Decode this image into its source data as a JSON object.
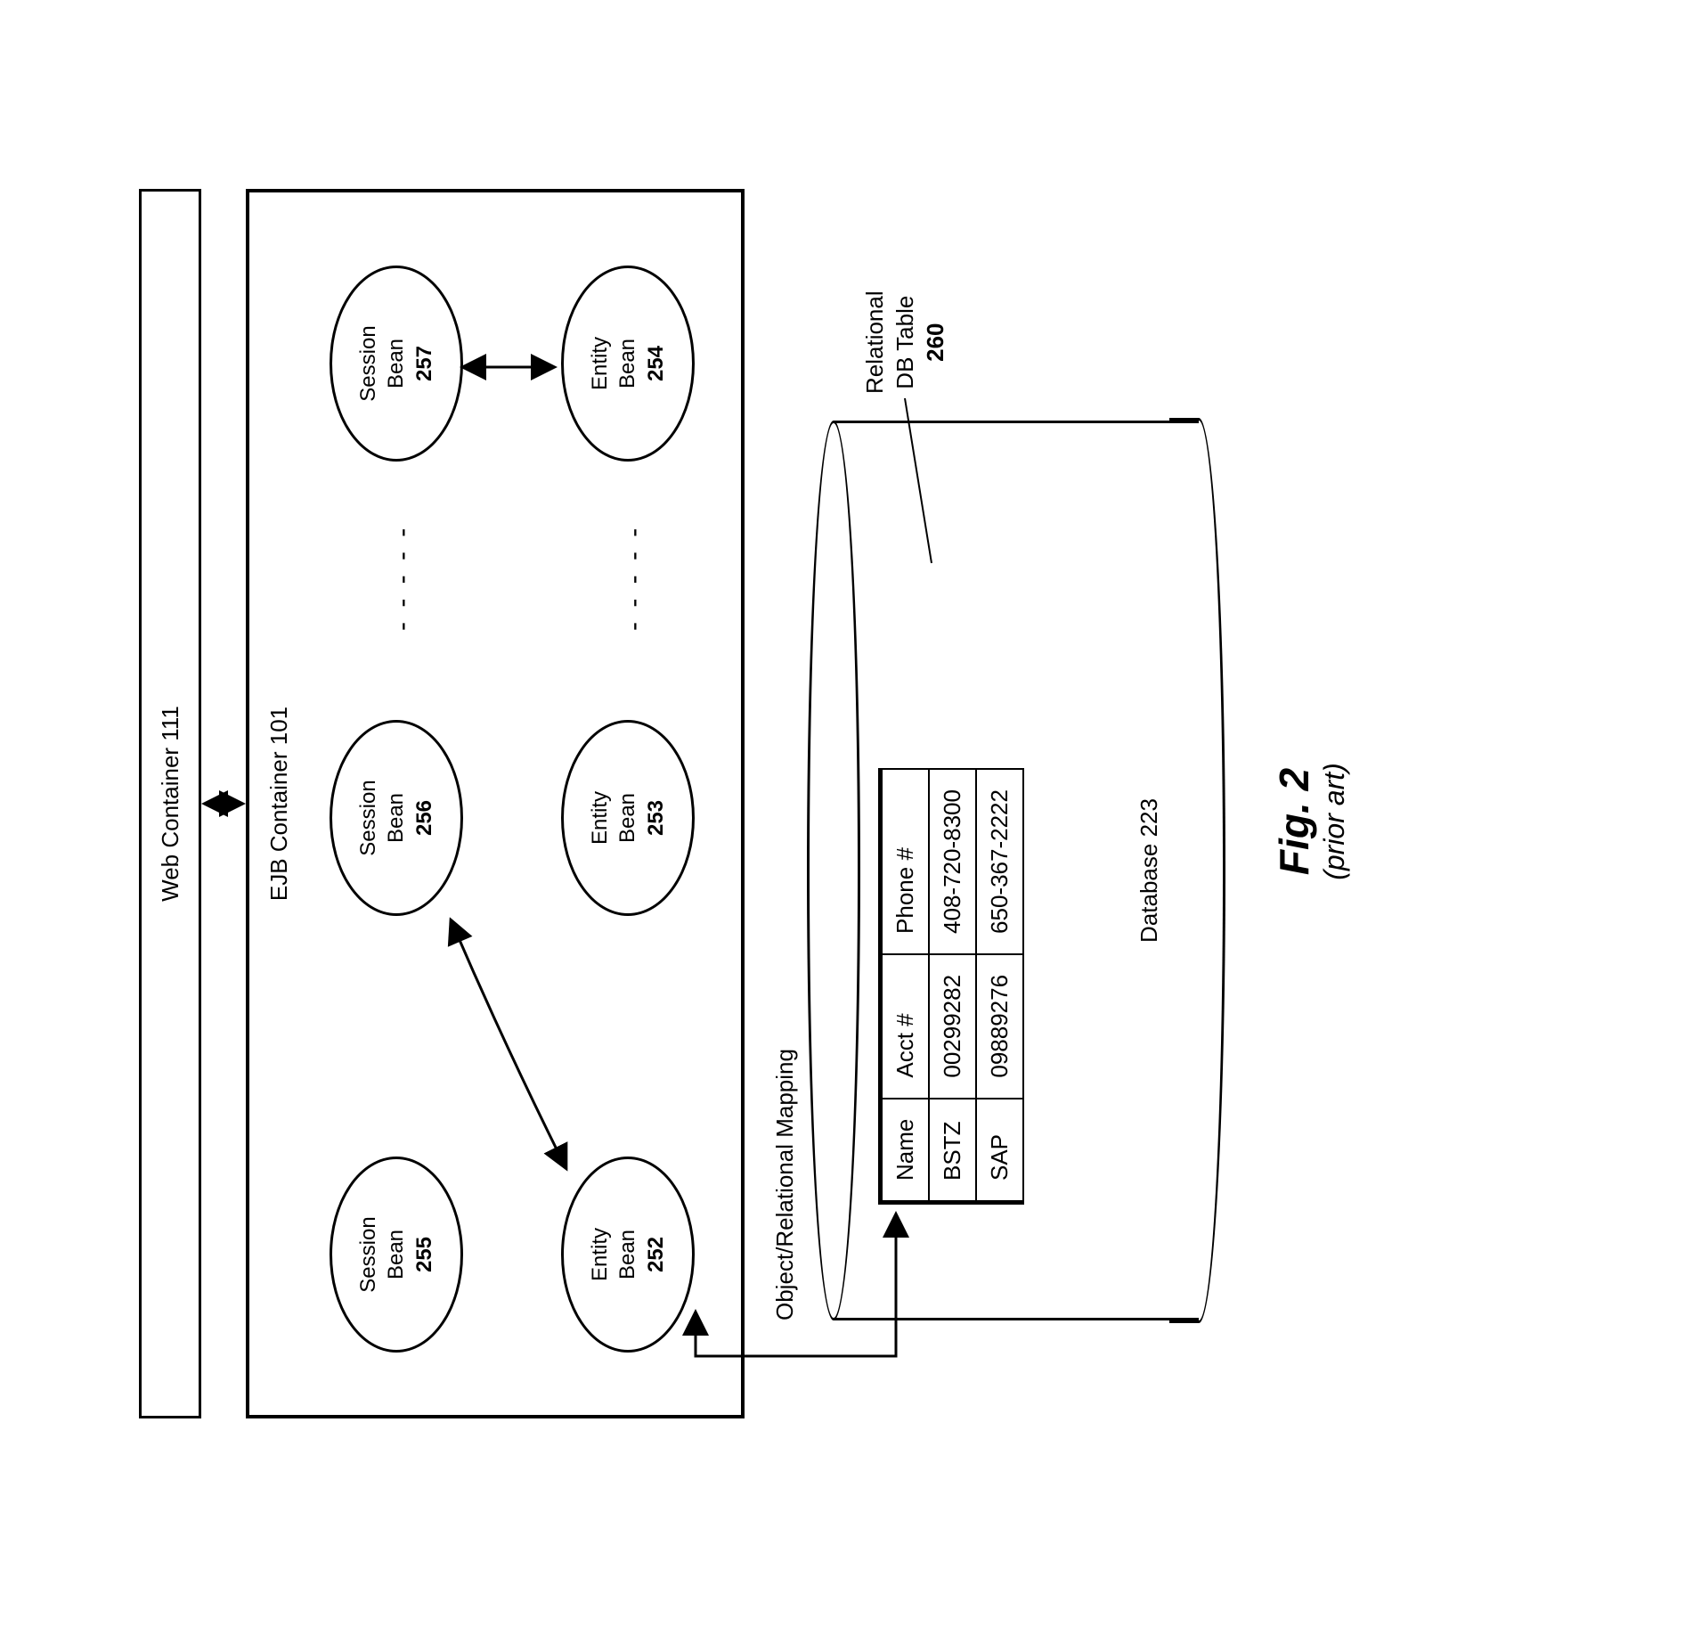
{
  "web_container": {
    "label": "Web Container 111"
  },
  "ejb_container": {
    "label": "EJB Container 101"
  },
  "beans": {
    "s255": {
      "type": "Session",
      "word": "Bean",
      "num": "255"
    },
    "s256": {
      "type": "Session",
      "word": "Bean",
      "num": "256"
    },
    "s257": {
      "type": "Session",
      "word": "Bean",
      "num": "257"
    },
    "e252": {
      "type": "Entity",
      "word": "Bean",
      "num": "252"
    },
    "e253": {
      "type": "Entity",
      "word": "Bean",
      "num": "253"
    },
    "e254": {
      "type": "Entity",
      "word": "Bean",
      "num": "254"
    }
  },
  "orm_label": "Object/Relational Mapping",
  "database": {
    "label": "Database 223"
  },
  "table": {
    "headers": [
      "Name",
      "Acct #",
      "Phone #"
    ],
    "rows": [
      [
        "BSTZ",
        "00299282",
        "408-720-8300"
      ],
      [
        "SAP",
        "09889276",
        "650-367-2222"
      ]
    ]
  },
  "rel_table_label": {
    "line1": "Relational",
    "line2": "DB Table",
    "num": "260"
  },
  "figure": {
    "title": "Fig. 2",
    "subtitle": "(prior art)"
  },
  "chart_data": {
    "type": "diagram",
    "title": "Fig. 2 (prior art)",
    "description": "EJB/Web container architecture with session beans, entity beans, and object/relational mapping to a database table.",
    "nodes": [
      {
        "id": "web111",
        "label": "Web Container 111",
        "kind": "container"
      },
      {
        "id": "ejb101",
        "label": "EJB Container 101",
        "kind": "container"
      },
      {
        "id": "s255",
        "label": "Session Bean 255",
        "kind": "session-bean",
        "parent": "ejb101"
      },
      {
        "id": "s256",
        "label": "Session Bean 256",
        "kind": "session-bean",
        "parent": "ejb101"
      },
      {
        "id": "s257",
        "label": "Session Bean 257",
        "kind": "session-bean",
        "parent": "ejb101"
      },
      {
        "id": "e252",
        "label": "Entity Bean 252",
        "kind": "entity-bean",
        "parent": "ejb101"
      },
      {
        "id": "e253",
        "label": "Entity Bean 253",
        "kind": "entity-bean",
        "parent": "ejb101"
      },
      {
        "id": "e254",
        "label": "Entity Bean 254",
        "kind": "entity-bean",
        "parent": "ejb101"
      },
      {
        "id": "db223",
        "label": "Database 223",
        "kind": "database"
      },
      {
        "id": "tbl260",
        "label": "Relational DB Table 260",
        "kind": "table",
        "parent": "db223"
      }
    ],
    "edges": [
      {
        "from": "web111",
        "to": "ejb101",
        "bidirectional": true
      },
      {
        "from": "s257",
        "to": "e254",
        "bidirectional": true
      },
      {
        "from": "s256",
        "to": "e252",
        "bidirectional": true
      },
      {
        "from": "e252",
        "to": "tbl260",
        "bidirectional": true,
        "label": "Object/Relational Mapping"
      }
    ],
    "table_data": {
      "columns": [
        "Name",
        "Acct #",
        "Phone #"
      ],
      "rows": [
        {
          "Name": "BSTZ",
          "Acct #": "00299282",
          "Phone #": "408-720-8300"
        },
        {
          "Name": "SAP",
          "Acct #": "09889276",
          "Phone #": "650-367-2222"
        }
      ]
    }
  }
}
